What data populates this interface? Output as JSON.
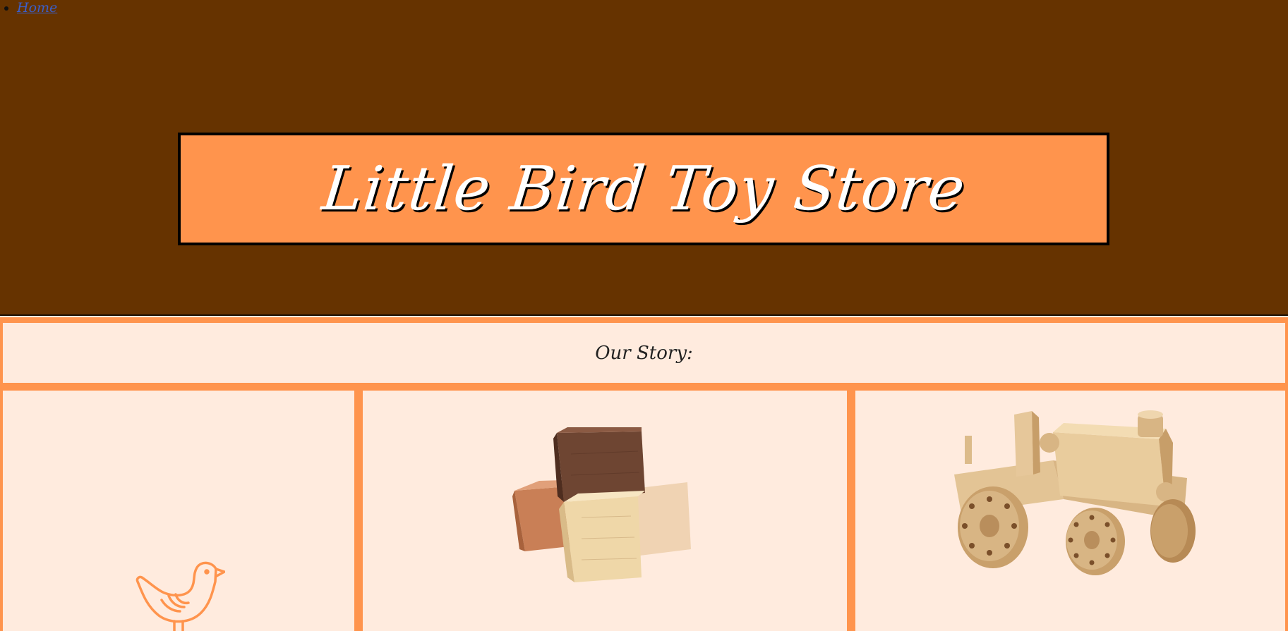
{
  "nav": {
    "items": [
      {
        "label": "Home"
      }
    ]
  },
  "header": {
    "title": "Little Bird Toy Store"
  },
  "main": {
    "story_heading": "Our Story:",
    "images": [
      {
        "icon": "bird-outline-icon"
      },
      {
        "icon": "wooden-blocks-image"
      },
      {
        "icon": "wooden-tractor-image"
      }
    ]
  },
  "colors": {
    "header_bg": "#663300",
    "accent": "#ff944d",
    "panel_bg": "#ffebde",
    "link": "#3b5fc9"
  }
}
